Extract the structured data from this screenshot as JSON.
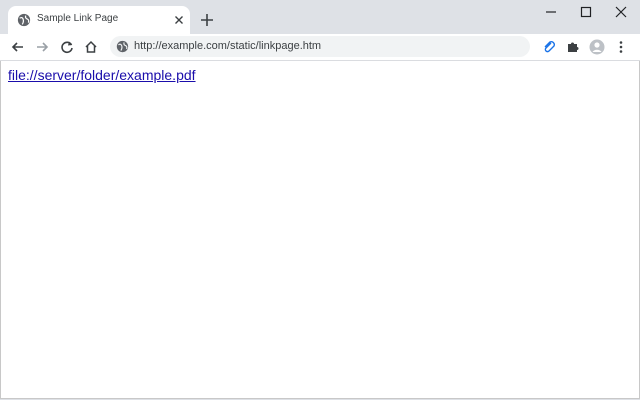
{
  "tab": {
    "title": "Sample Link Page"
  },
  "address_bar": {
    "url": "http://example.com/static/linkpage.htm"
  },
  "page": {
    "link_text": "file://server/folder/example.pdf"
  },
  "colors": {
    "accent": "#1a73e8",
    "link": "#1a0dab",
    "tabstrip": "#dee1e6"
  }
}
